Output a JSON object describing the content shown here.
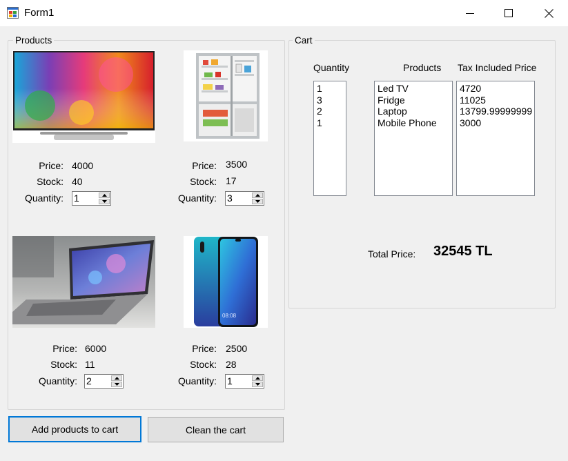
{
  "window": {
    "title": "Form1"
  },
  "products_group": {
    "label": "Products",
    "items": [
      {
        "name": "TV",
        "price_label": "Price:",
        "price": "4000",
        "stock_label": "Stock:",
        "stock": "40",
        "qty_label": "Quantity:",
        "qty": "1"
      },
      {
        "name": "Fridge",
        "price_label": "Price:",
        "price": "3500",
        "stock_label": "Stock:",
        "stock": "17",
        "qty_label": "Quantity:",
        "qty": "3"
      },
      {
        "name": "Laptop",
        "price_label": "Price:",
        "price": "6000",
        "stock_label": "Stock:",
        "stock": "11",
        "qty_label": "Quantity:",
        "qty": "2"
      },
      {
        "name": "Mobile Phone",
        "price_label": "Price:",
        "price": "2500",
        "stock_label": "Stock:",
        "stock": "28",
        "qty_label": "Quantity:",
        "qty": "1"
      }
    ]
  },
  "cart": {
    "label": "Cart",
    "headers": {
      "quantity": "Quantity",
      "products": "Products",
      "price": "Tax Included Price"
    },
    "quantities": [
      "1",
      "3",
      "2",
      "1"
    ],
    "products": [
      "Led TV",
      "Fridge",
      "Laptop",
      "Mobile Phone"
    ],
    "prices": [
      "4720",
      "11025",
      "13799.99999999",
      "3000"
    ],
    "total_label": "Total Price:",
    "total_value": "32545 TL"
  },
  "buttons": {
    "add": "Add products to cart",
    "clean": "Clean the cart"
  },
  "icons": {
    "minimize": "minimize-icon",
    "maximize": "maximize-icon",
    "close": "close-icon",
    "app": "form-app-icon"
  }
}
